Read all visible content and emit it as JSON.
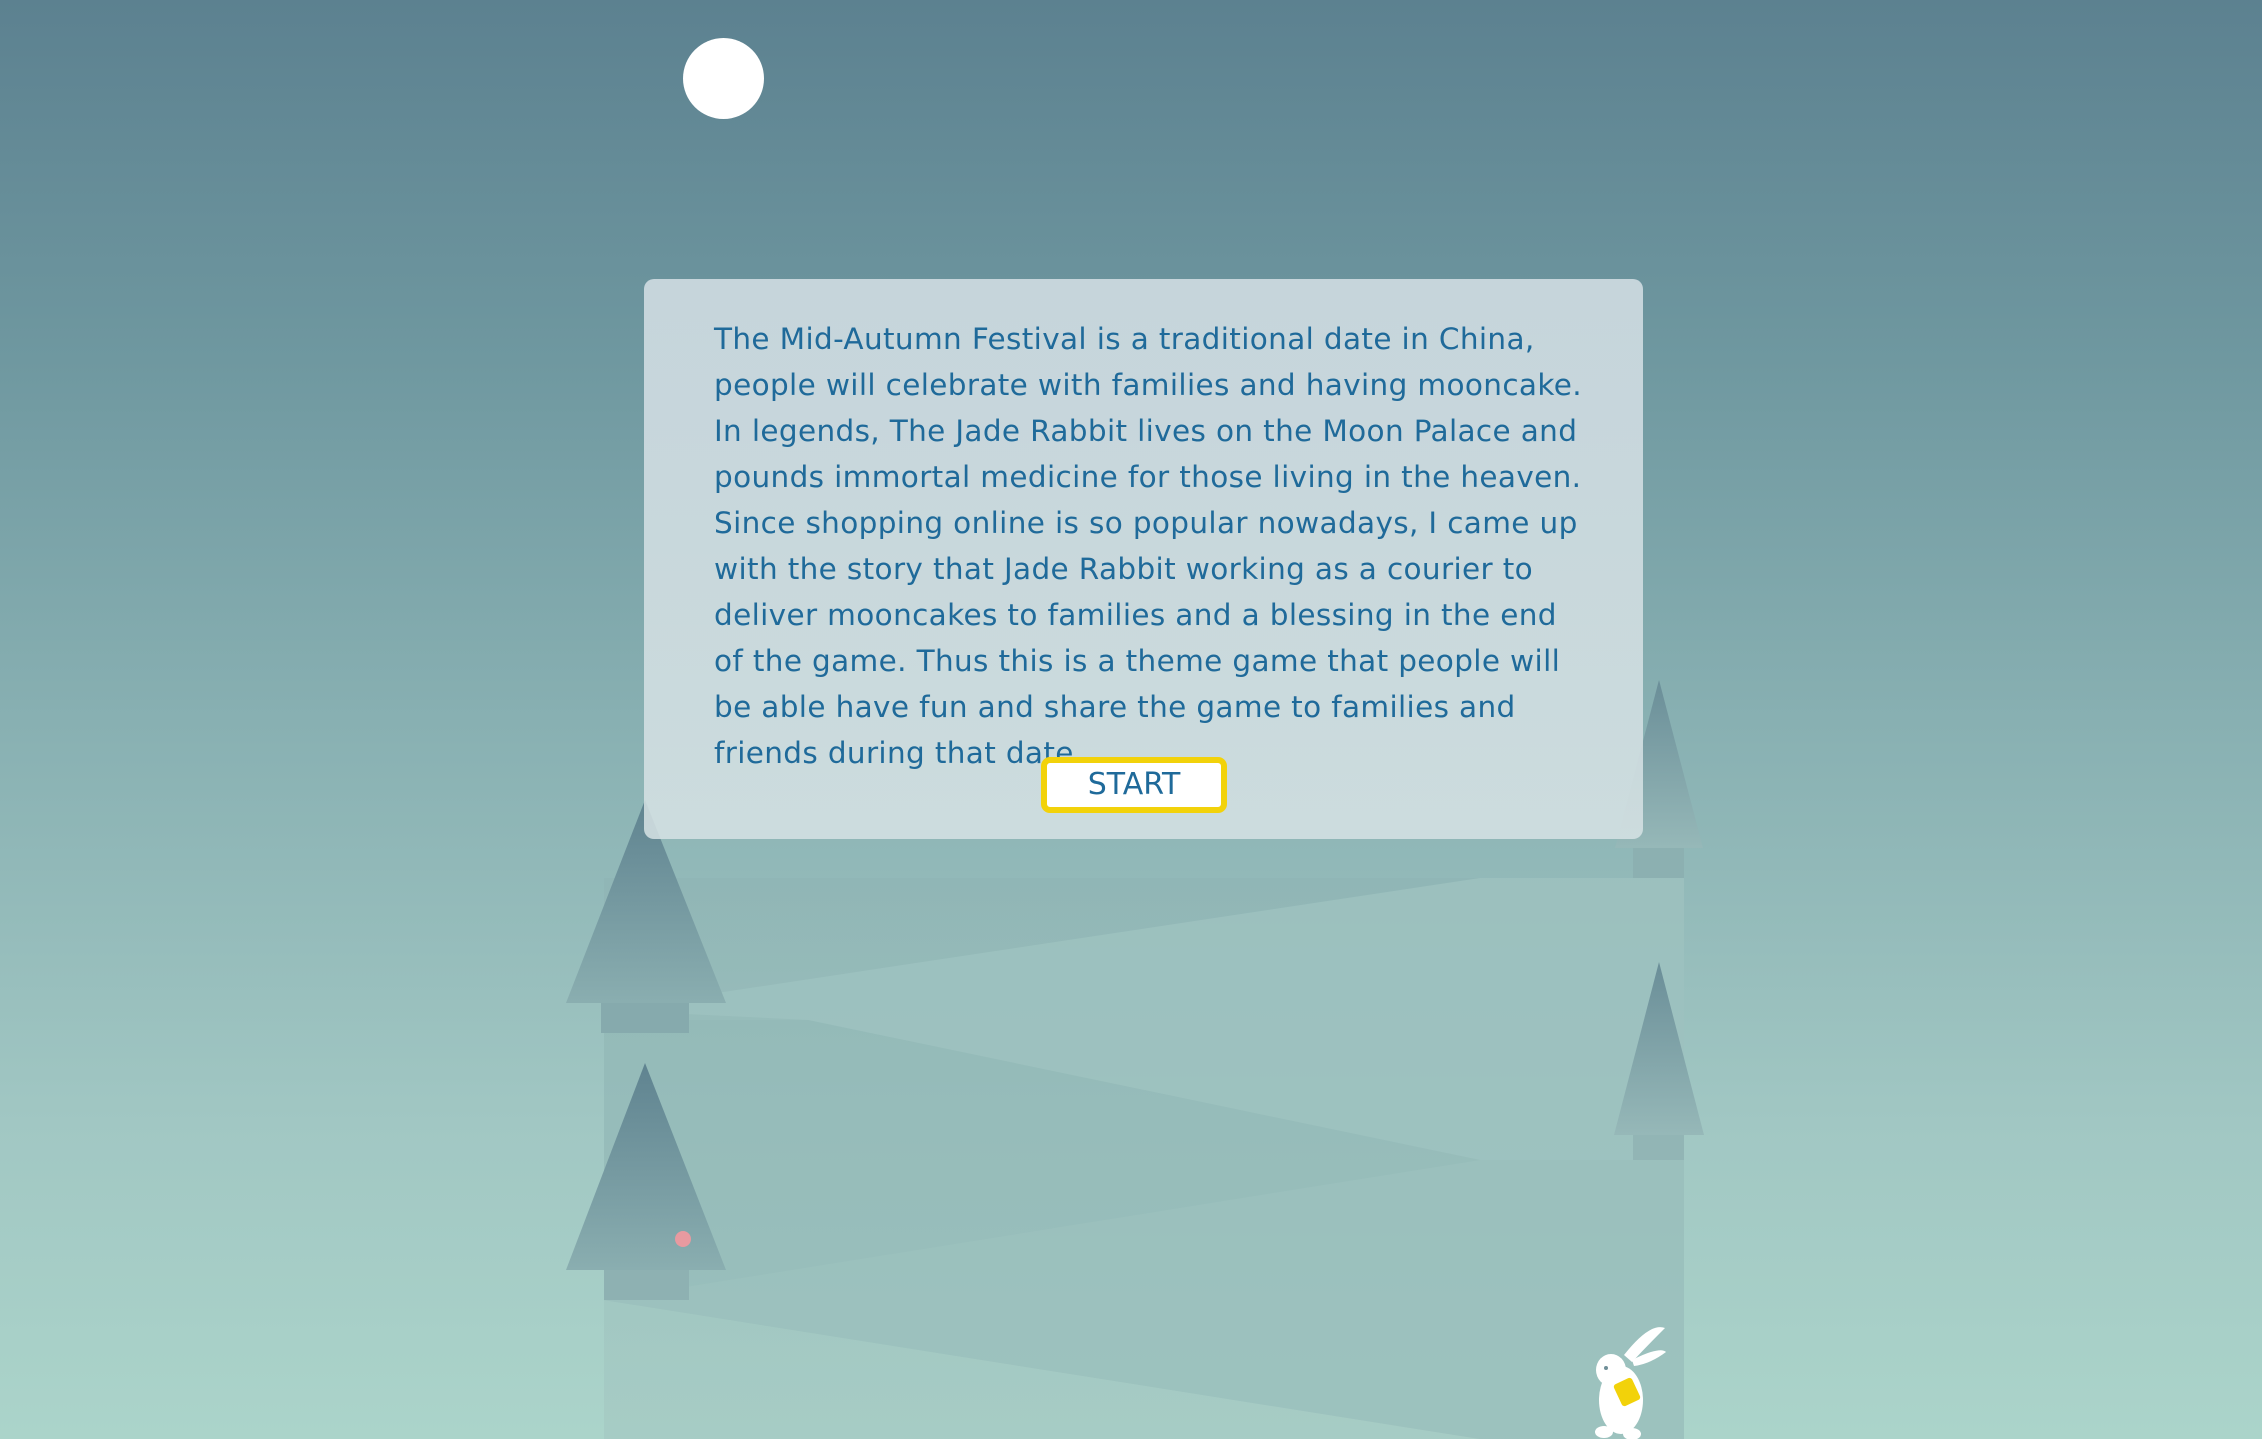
{
  "intro": {
    "text": "The Mid-Autumn Festival is a traditional date in China, people will celebrate with families and having mooncake. In legends, The Jade Rabbit lives on the Moon Palace and pounds immortal medicine for those living in the heaven. Since shopping online is so popular nowadays, I came up with the story that Jade Rabbit working as a courier to deliver mooncakes to families and a blessing in the end of the game. Thus this is a theme game that people will be able have fun and share the game to families and friends during that date."
  },
  "start_button": {
    "label": "START",
    "border_color": "#f2d20a"
  },
  "colors": {
    "text": "#1f6a9a",
    "sky_top": "#5c8190",
    "sky_bottom": "#abd4ca",
    "moon": "#ffffff",
    "collectible": "#e89aa0",
    "rabbit_bag": "#f2d20a"
  },
  "scene": {
    "icons": [
      "moon-icon",
      "tree-icon",
      "jade-rabbit-icon",
      "mooncake-dot-icon"
    ]
  }
}
